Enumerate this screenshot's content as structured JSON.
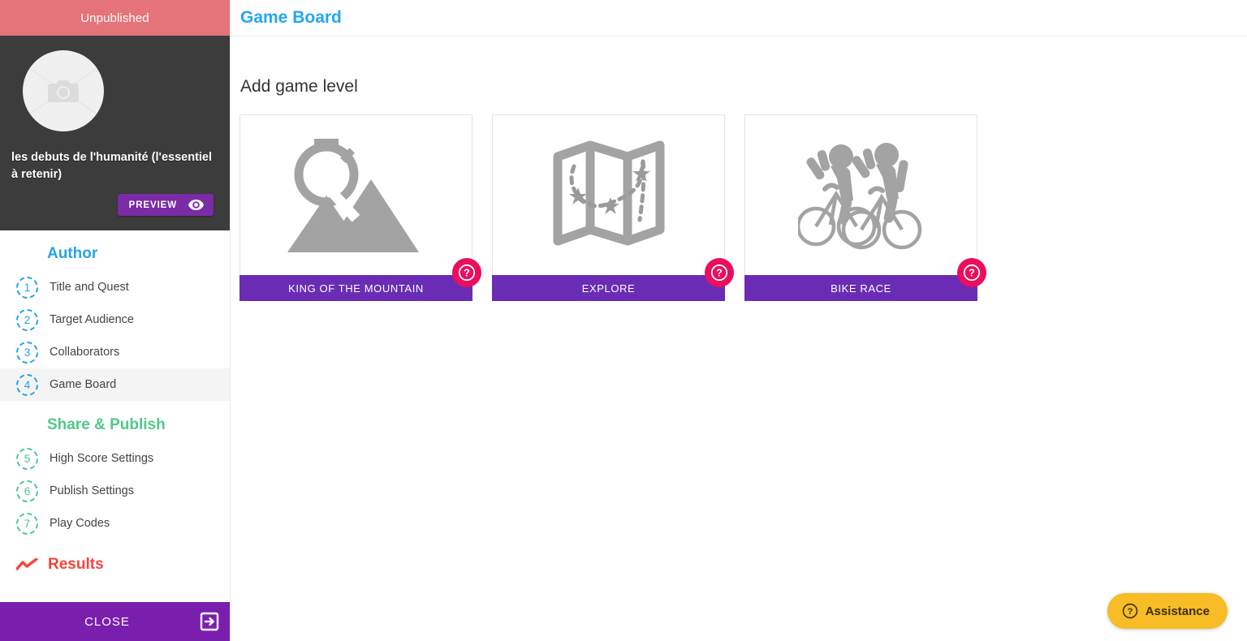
{
  "sidebar": {
    "status_banner": "Unpublished",
    "avatar_icon": "camera-placeholder-icon",
    "project_title": "les debuts de l'humanité (l'essentiel à retenir)",
    "preview_button": {
      "label": "PREVIEW",
      "icon": "eye-icon"
    },
    "sections": [
      {
        "heading": "Author",
        "color": "#29a3e8",
        "items": [
          {
            "num": "1",
            "label": "Title and Quest",
            "active": false
          },
          {
            "num": "2",
            "label": "Target Audience",
            "active": false
          },
          {
            "num": "3",
            "label": "Collaborators",
            "active": false
          },
          {
            "num": "4",
            "label": "Game Board",
            "active": true
          }
        ]
      },
      {
        "heading": "Share & Publish",
        "color": "#4fc98a",
        "items": [
          {
            "num": "5",
            "label": "High Score Settings",
            "active": false
          },
          {
            "num": "6",
            "label": "Publish Settings",
            "active": false
          },
          {
            "num": "7",
            "label": "Play Codes",
            "active": false
          }
        ]
      },
      {
        "heading": "Results",
        "color": "#f4453c",
        "icon": "trend-line-icon",
        "items": []
      }
    ],
    "close_button": {
      "label": "CLOSE",
      "icon": "exit-icon"
    },
    "scrollbar": {
      "up_icon": "scroll-up-arrow-icon",
      "down_icon": "scroll-down-arrow-icon"
    }
  },
  "main": {
    "header_title": "Game Board",
    "section_title": "Add game level",
    "cards": [
      {
        "label": "KING OF THE MOUNTAIN",
        "icon": "stopwatch-mountain-icon",
        "help_icon": "help-question-icon"
      },
      {
        "label": "EXPLORE",
        "icon": "folded-map-icon",
        "help_icon": "help-question-icon"
      },
      {
        "label": "BIKE RACE",
        "icon": "cyclists-icon",
        "help_icon": "help-question-icon"
      }
    ],
    "assistance_button": {
      "label": "Assistance",
      "icon": "question-circle-icon"
    }
  },
  "colors": {
    "unpublished_banner": "#e5737a",
    "author_blue": "#29a3e8",
    "publish_green": "#4fc98a",
    "results_red": "#f4453c",
    "card_purple": "#6a2cb5",
    "help_badge_pink": "#ec0d5c",
    "assistance_amber": "#f7bc26",
    "close_purple": "#7a1fad"
  }
}
